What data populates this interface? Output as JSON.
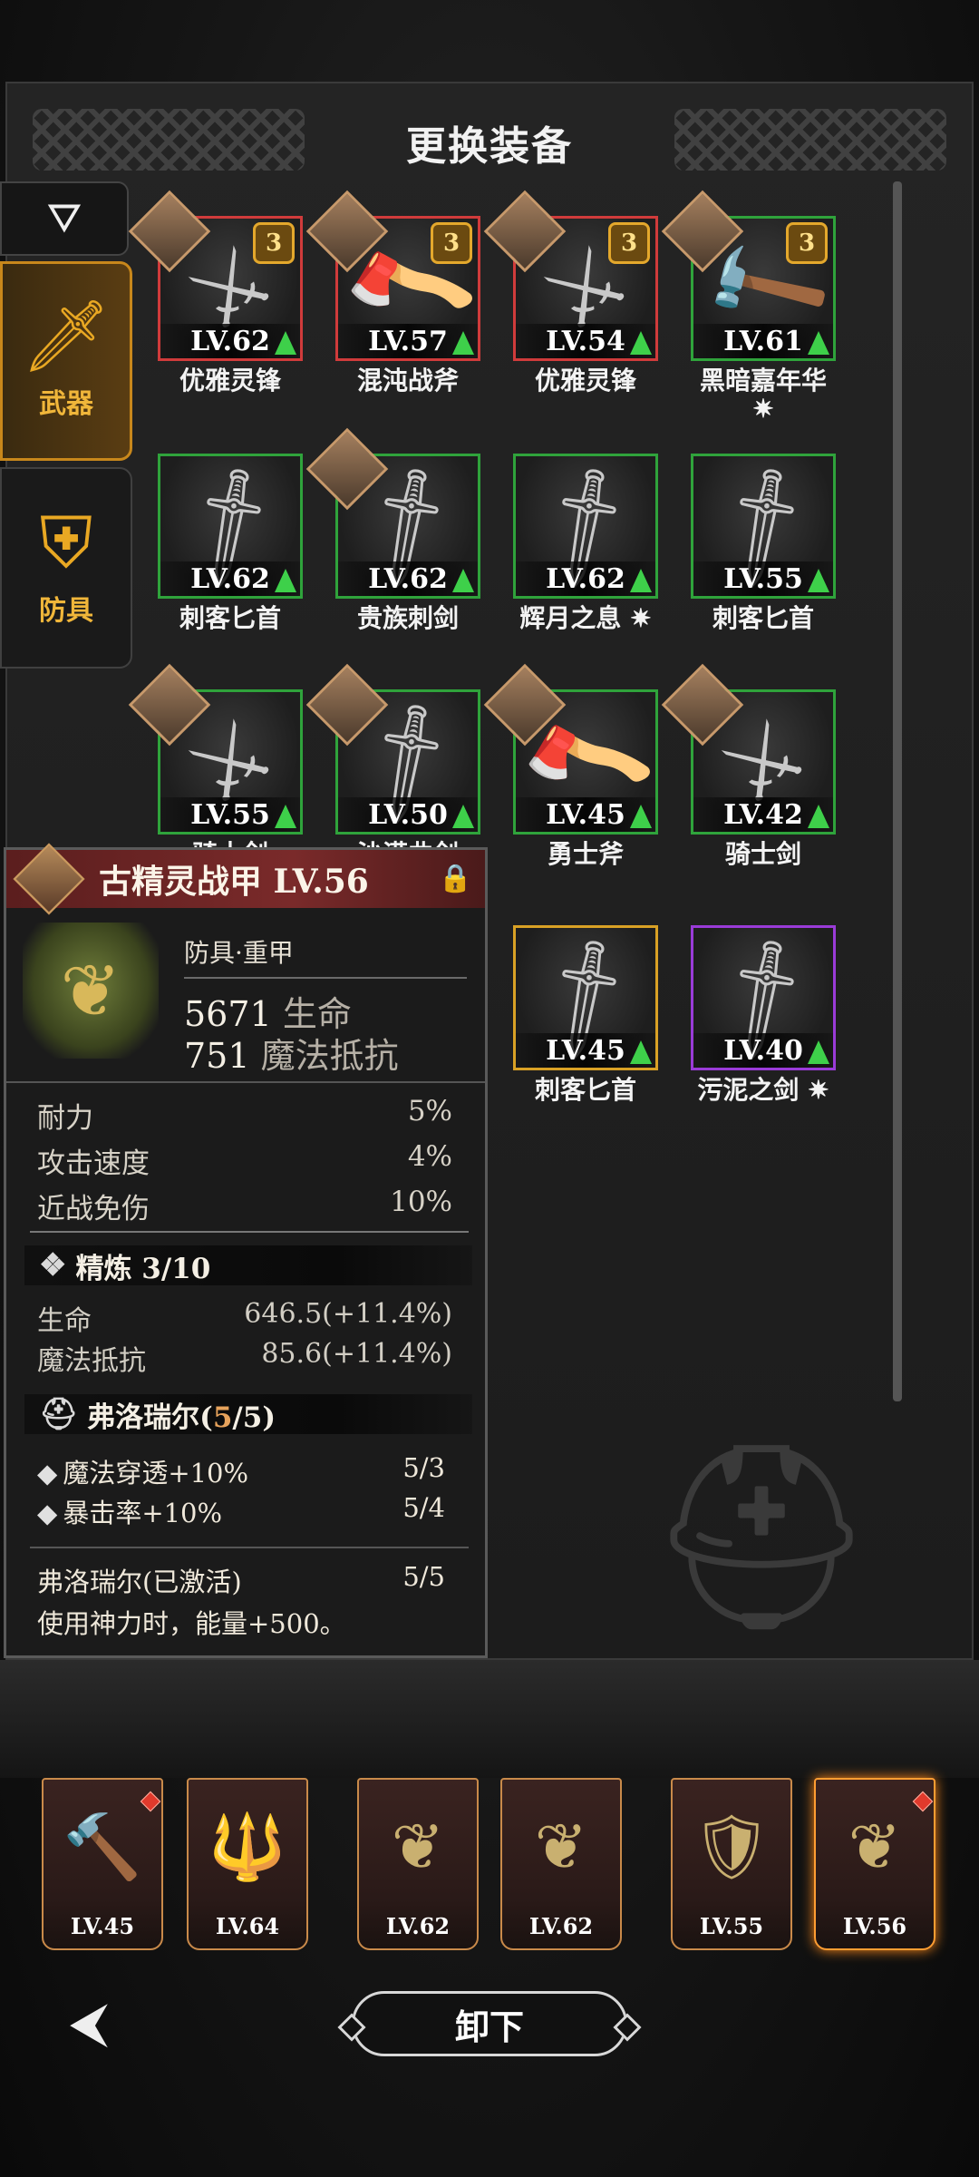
{
  "header": {
    "title": "更换装备"
  },
  "tabs": {
    "filter_icon": "filter-icon",
    "weapons": {
      "label": "武器",
      "icon": "sword-icon"
    },
    "armor": {
      "label": "防具",
      "icon": "armor-icon"
    }
  },
  "grid": [
    {
      "name": "优雅灵锋",
      "level": "LV.62",
      "frame": "red",
      "badge": "3",
      "upgrade": true
    },
    {
      "name": "混沌战斧",
      "level": "LV.57",
      "frame": "red",
      "badge": "3",
      "upgrade": true
    },
    {
      "name": "优雅灵锋",
      "level": "LV.54",
      "frame": "red",
      "badge": "3",
      "upgrade": true
    },
    {
      "name": "黑暗嘉年华",
      "level": "LV.61",
      "frame": "green",
      "badge": "3",
      "upgrade": true,
      "name2": "✷"
    },
    {
      "name": "刺客匕首",
      "level": "LV.62",
      "frame": "green",
      "upgrade": true
    },
    {
      "name": "贵族刺剑",
      "level": "LV.62",
      "frame": "green",
      "upgrade": true
    },
    {
      "name": "辉月之息 ✷",
      "level": "LV.62",
      "frame": "green",
      "upgrade": true
    },
    {
      "name": "刺客匕首",
      "level": "LV.55",
      "frame": "green",
      "upgrade": true
    },
    {
      "name": "骑士剑",
      "level": "LV.55",
      "frame": "green",
      "upgrade": true
    },
    {
      "name": "沙漠曲剑",
      "level": "LV.50",
      "frame": "green",
      "upgrade": true
    },
    {
      "name": "勇士斧",
      "level": "LV.45",
      "frame": "green",
      "upgrade": true
    },
    {
      "name": "骑士剑",
      "level": "LV.42",
      "frame": "green",
      "upgrade": true
    },
    {
      "name": "刺客匕首",
      "level": "LV.45",
      "frame": "gold",
      "upgrade": true
    },
    {
      "name": "污泥之剑 ✷",
      "level": "LV.40",
      "frame": "purple",
      "upgrade": true
    }
  ],
  "detail": {
    "title": "古精灵战甲 LV.56",
    "category": "防具·重甲",
    "main_stats": [
      {
        "value": "5671",
        "unit": "生命"
      },
      {
        "value": "751",
        "unit": "魔法抵抗"
      }
    ],
    "stats": [
      {
        "label": "耐力",
        "value": "5%"
      },
      {
        "label": "攻击速度",
        "value": "4%"
      },
      {
        "label": "近战免伤",
        "value": "10%"
      }
    ],
    "refine": {
      "label": "精炼 3/10",
      "rows": [
        {
          "label": "生命",
          "value": "646.5(+11.4%)"
        },
        {
          "label": "魔法抵抗",
          "value": "85.6(+11.4%)"
        }
      ]
    },
    "set": {
      "name_prefix": "弗洛瑞尔(",
      "count_hl": "5",
      "name_suffix": "/5)",
      "rows": [
        {
          "label": "魔法穿透+10%",
          "value": "5/3"
        },
        {
          "label": "暴击率+10%",
          "value": "5/4"
        }
      ],
      "active_label": "弗洛瑞尔(已激活)",
      "active_value": "5/5",
      "desc": "使用神力时，能量+500。"
    }
  },
  "equipped": [
    {
      "level": "LV.45",
      "icon": "hammer-icon",
      "dot": true
    },
    {
      "level": "LV.64",
      "icon": "spear-icon",
      "dot": false
    },
    {
      "level": "LV.62",
      "icon": "armor-icon",
      "dot": false
    },
    {
      "level": "LV.62",
      "icon": "armor-icon",
      "dot": false
    },
    {
      "level": "LV.55",
      "icon": "shield-icon",
      "dot": false
    },
    {
      "level": "LV.56",
      "icon": "armor-icon",
      "dot": true,
      "selected": true
    }
  ],
  "footer": {
    "unequip_label": "卸下"
  }
}
